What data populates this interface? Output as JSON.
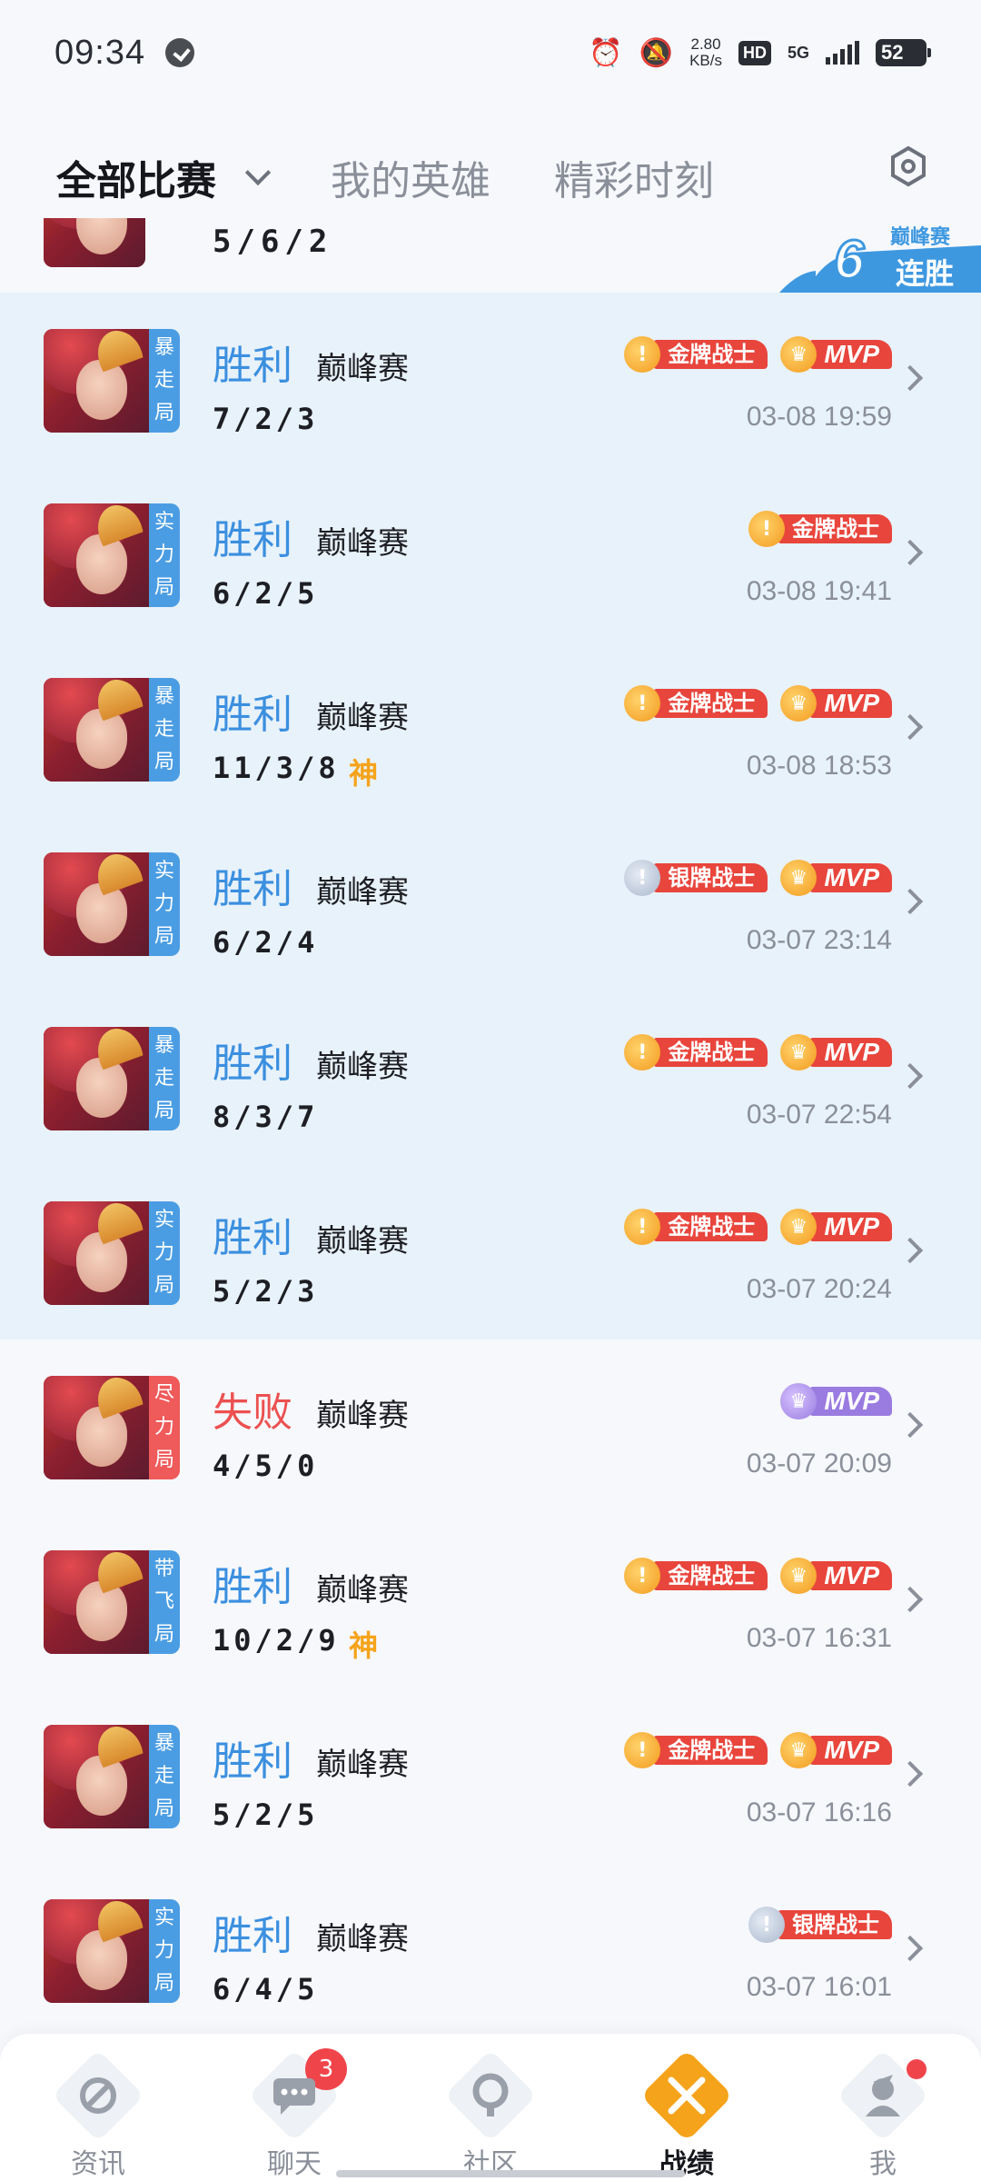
{
  "status_bar": {
    "time": "09:34",
    "speed_value": "2.80",
    "speed_unit": "KB/s",
    "hd": "HD",
    "network": "5G",
    "battery": "52"
  },
  "tabs": [
    {
      "label": "全部比赛",
      "active": true
    },
    {
      "label": "我的英雄",
      "active": false
    },
    {
      "label": "精彩时刻",
      "active": false
    }
  ],
  "streak_banner": {
    "count": "6",
    "mode": "巅峰赛",
    "text": "连胜"
  },
  "partial_row": {
    "kda": "5/6/2"
  },
  "matches": [
    {
      "tag": [
        "暴",
        "走",
        "局"
      ],
      "tag_color": "blue",
      "result": "胜利",
      "mode": "巅峰赛",
      "kda": "7/2/3",
      "god": "",
      "time": "03-08 19:59",
      "badges": [
        {
          "type": "gold",
          "icon": "!",
          "label": "金牌战士"
        },
        {
          "type": "mvp",
          "icon": "♛",
          "label": "MVP"
        }
      ]
    },
    {
      "tag": [
        "实",
        "力",
        "局"
      ],
      "tag_color": "blue",
      "result": "胜利",
      "mode": "巅峰赛",
      "kda": "6/2/5",
      "god": "",
      "time": "03-08 19:41",
      "badges": [
        {
          "type": "gold",
          "icon": "!",
          "label": "金牌战士"
        }
      ]
    },
    {
      "tag": [
        "暴",
        "走",
        "局"
      ],
      "tag_color": "blue",
      "result": "胜利",
      "mode": "巅峰赛",
      "kda": "11/3/8",
      "god": "神",
      "time": "03-08 18:53",
      "badges": [
        {
          "type": "gold",
          "icon": "!",
          "label": "金牌战士"
        },
        {
          "type": "mvp",
          "icon": "♛",
          "label": "MVP"
        }
      ]
    },
    {
      "tag": [
        "实",
        "力",
        "局"
      ],
      "tag_color": "blue",
      "result": "胜利",
      "mode": "巅峰赛",
      "kda": "6/2/4",
      "god": "",
      "time": "03-07 23:14",
      "badges": [
        {
          "type": "silver",
          "icon": "!",
          "label": "银牌战士"
        },
        {
          "type": "mvp",
          "icon": "♛",
          "label": "MVP"
        }
      ]
    },
    {
      "tag": [
        "暴",
        "走",
        "局"
      ],
      "tag_color": "blue",
      "result": "胜利",
      "mode": "巅峰赛",
      "kda": "8/3/7",
      "god": "",
      "time": "03-07 22:54",
      "badges": [
        {
          "type": "gold",
          "icon": "!",
          "label": "金牌战士"
        },
        {
          "type": "mvp",
          "icon": "♛",
          "label": "MVP"
        }
      ]
    },
    {
      "tag": [
        "实",
        "力",
        "局"
      ],
      "tag_color": "blue",
      "result": "胜利",
      "mode": "巅峰赛",
      "kda": "5/2/3",
      "god": "",
      "time": "03-07 20:24",
      "badges": [
        {
          "type": "gold",
          "icon": "!",
          "label": "金牌战士"
        },
        {
          "type": "mvp",
          "icon": "♛",
          "label": "MVP"
        }
      ]
    },
    {
      "tag": [
        "尽",
        "力",
        "局"
      ],
      "tag_color": "red",
      "result": "失败",
      "mode": "巅峰赛",
      "kda": "4/5/0",
      "god": "",
      "time": "03-07 20:09",
      "badges": [
        {
          "type": "mvp-purple",
          "icon": "♛",
          "label": "MVP"
        }
      ]
    },
    {
      "tag": [
        "带",
        "飞",
        "局"
      ],
      "tag_color": "blue",
      "result": "胜利",
      "mode": "巅峰赛",
      "kda": "10/2/9",
      "god": "神",
      "time": "03-07 16:31",
      "badges": [
        {
          "type": "gold",
          "icon": "!",
          "label": "金牌战士"
        },
        {
          "type": "mvp",
          "icon": "♛",
          "label": "MVP"
        }
      ]
    },
    {
      "tag": [
        "暴",
        "走",
        "局"
      ],
      "tag_color": "blue",
      "result": "胜利",
      "mode": "巅峰赛",
      "kda": "5/2/5",
      "god": "",
      "time": "03-07 16:16",
      "badges": [
        {
          "type": "gold",
          "icon": "!",
          "label": "金牌战士"
        },
        {
          "type": "mvp",
          "icon": "♛",
          "label": "MVP"
        }
      ]
    },
    {
      "tag": [
        "实",
        "力",
        "局"
      ],
      "tag_color": "blue",
      "result": "胜利",
      "mode": "巅峰赛",
      "kda": "6/4/5",
      "god": "",
      "time": "03-07 16:01",
      "badges": [
        {
          "type": "silver",
          "icon": "!",
          "label": "银牌战士"
        }
      ]
    }
  ],
  "bottom_nav": [
    {
      "label": "资讯",
      "icon": "news-icon",
      "badge": ""
    },
    {
      "label": "聊天",
      "icon": "chat-icon",
      "badge": "3"
    },
    {
      "label": "社区",
      "icon": "community-icon",
      "badge": ""
    },
    {
      "label": "战绩",
      "icon": "record-icon",
      "badge": "",
      "active": true
    },
    {
      "label": "我",
      "icon": "profile-icon",
      "badge": "",
      "dot": true
    }
  ],
  "colors": {
    "accent": "#f5a31a",
    "win": "#3b8fdf",
    "lose": "#ec5050",
    "highlight_bg": "#e8f2fb"
  }
}
